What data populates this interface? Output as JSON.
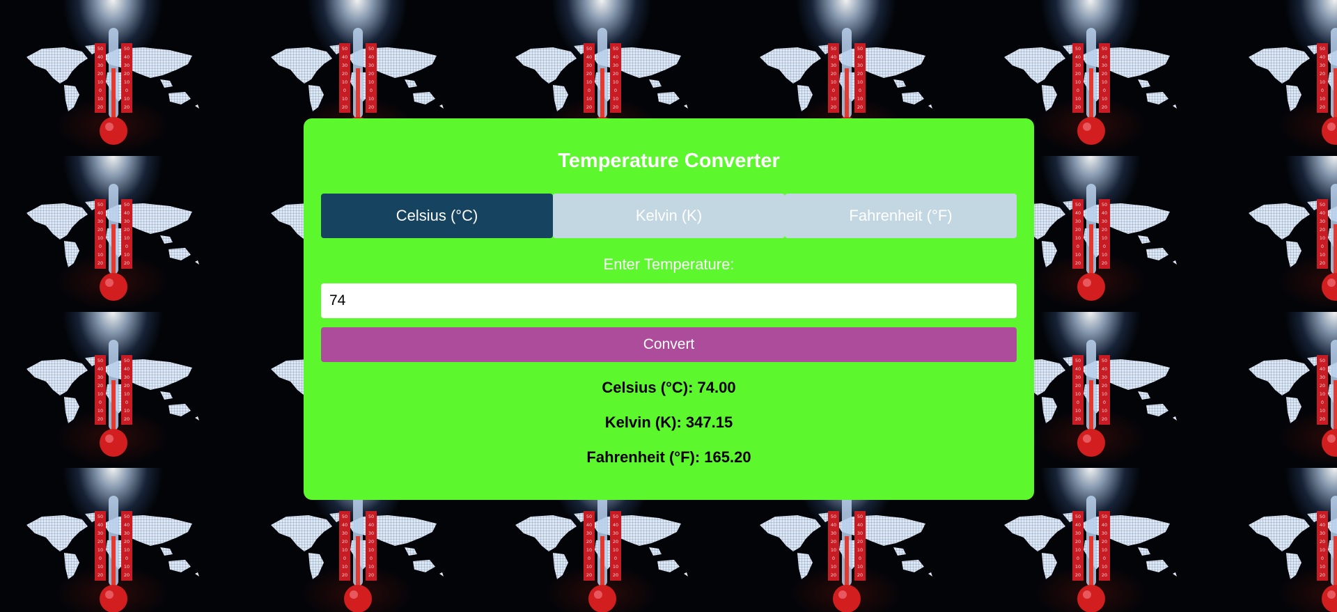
{
  "app": {
    "title": "Temperature Converter"
  },
  "tabs": [
    {
      "label": "Celsius (°C)",
      "active": true
    },
    {
      "label": "Kelvin (K)",
      "active": false
    },
    {
      "label": "Fahrenheit (°F)",
      "active": false
    }
  ],
  "form": {
    "label": "Enter Temperature:",
    "value": "74",
    "convert_label": "Convert"
  },
  "results": {
    "celsius": "Celsius (°C): 74.00",
    "kelvin": "Kelvin (K): 347.15",
    "fahrenheit": "Fahrenheit (°F): 165.20"
  },
  "background": {
    "pattern": "thermometer-world-map-tile",
    "thermometer_scale_labels": [
      "50",
      "40",
      "30",
      "20",
      "10",
      "0",
      "10",
      "20"
    ]
  },
  "colors": {
    "card": "#5cf72d",
    "active_tab": "#16435f",
    "inactive_tab": "#c3d7e3",
    "convert_button": "#ad4c9a",
    "thermometer_red": "#d21e1e"
  }
}
